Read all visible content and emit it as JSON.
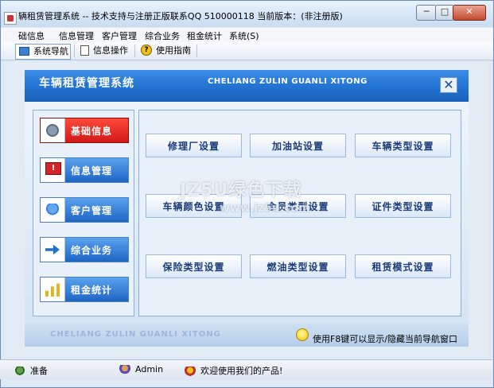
{
  "window": {
    "title": "辆租赁管理系统 -- 技术支持与注册正版联系QQ 510000118    当前版本：(非注册版)",
    "minimize": "─",
    "maximize": "□",
    "close": "✕"
  },
  "menu": [
    "础信息",
    "信息管理",
    "客户管理",
    "综合业务",
    "租金统计",
    "系统(S)"
  ],
  "toolbar": [
    {
      "label": "系统导航",
      "icon": "monitor-icon",
      "active": true
    },
    {
      "label": "信息操作",
      "icon": "document-icon",
      "active": false
    },
    {
      "label": "使用指南",
      "icon": "help-icon",
      "active": false
    }
  ],
  "header": {
    "title": "车辆租赁管理系统",
    "subtitle": "CHELIANG ZULIN GUANLI XITONG",
    "close": "✕"
  },
  "sidebar": [
    {
      "label": "基础信息",
      "icon": "gear-icon",
      "active": true
    },
    {
      "label": "信息管理",
      "icon": "warning-icon",
      "active": false
    },
    {
      "label": "客户管理",
      "icon": "users-icon",
      "active": false
    },
    {
      "label": "综合业务",
      "icon": "arrow-icon",
      "active": false
    },
    {
      "label": "租金统计",
      "icon": "chart-icon",
      "active": false
    }
  ],
  "grid": [
    [
      "修理厂设置",
      "加油站设置",
      "车辆类型设置"
    ],
    [
      "车辆颜色设置",
      "会员类型设置",
      "证件类型设置"
    ],
    [
      "保险类型设置",
      "燃油类型设置",
      "租赁模式设置"
    ]
  ],
  "footer": {
    "watermark": "CHELIANG ZULIN GUANLI XITONG",
    "hint": "使用F8键可以显示/隐藏当前导航窗口"
  },
  "status": {
    "ready": "准备",
    "user": "Admin",
    "message": "欢迎使用我们的产品!"
  },
  "overlay_watermark": {
    "line1": "JZ5U绿色下载",
    "line2": "www.jz5u.com"
  }
}
